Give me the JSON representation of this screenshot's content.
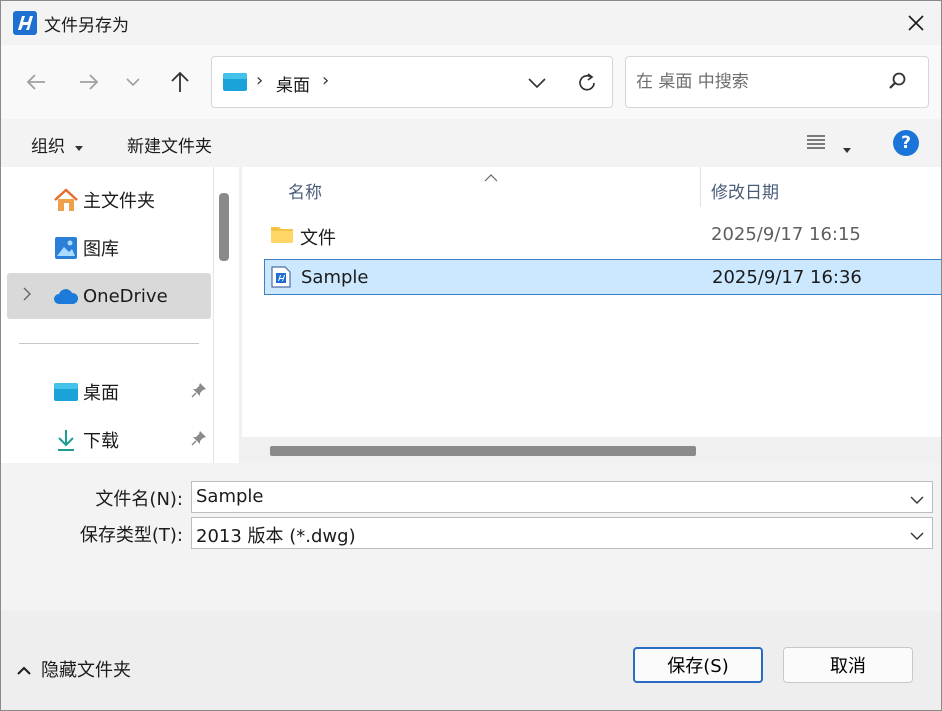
{
  "window": {
    "title": "文件另存为"
  },
  "address": {
    "crumb": "桌面",
    "sep": "›"
  },
  "search": {
    "placeholder": "在 桌面 中搜索"
  },
  "toolbar": {
    "organize": "组织",
    "new_folder": "新建文件夹",
    "help": "?"
  },
  "nav": {
    "items": [
      {
        "label": "主文件夹",
        "icon": "home-icon"
      },
      {
        "label": "图库",
        "icon": "gallery-icon"
      },
      {
        "label": "OneDrive",
        "icon": "onedrive-icon"
      },
      {
        "label": "桌面",
        "icon": "desktop-folder-icon"
      },
      {
        "label": "下载",
        "icon": "download-icon"
      }
    ]
  },
  "files": {
    "columns": {
      "name": "名称",
      "date": "修改日期"
    },
    "rows": [
      {
        "name": "文件",
        "date": "2025/9/17 16:15",
        "icon": "folder-icon"
      },
      {
        "name": "Sample",
        "date": "2025/9/17 16:36",
        "icon": "dwg-file-icon"
      }
    ]
  },
  "form": {
    "filename_label": "文件名(N):",
    "filename_value": "Sample",
    "type_label": "保存类型(T):",
    "type_value": "2013 版本 (*.dwg)"
  },
  "footer": {
    "hide_folders": "隐藏文件夹",
    "save": "保存(S)",
    "cancel": "取消"
  },
  "colors": {
    "accent": "#1b74d8",
    "selection": "#cce8ff",
    "selection_border": "#3d82c4"
  }
}
